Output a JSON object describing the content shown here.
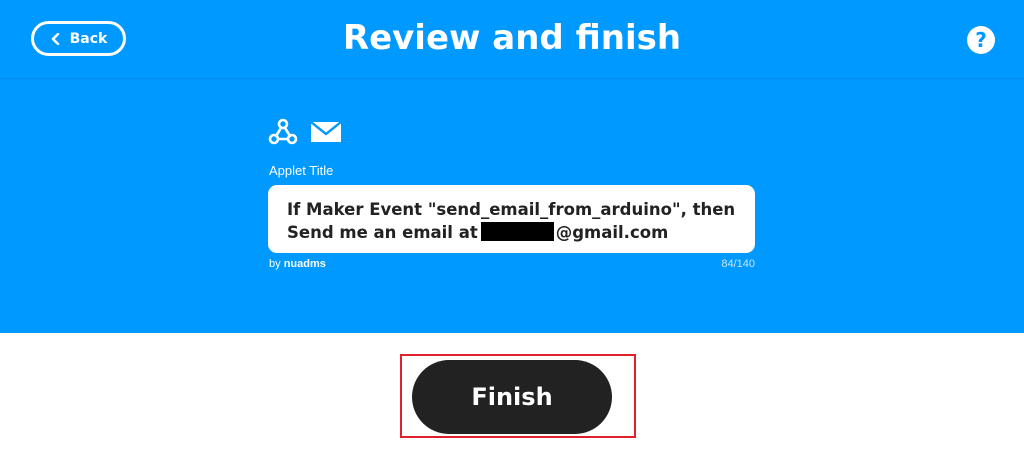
{
  "header": {
    "back_label": "Back",
    "title": "Review and finish",
    "help_label": "?"
  },
  "applet": {
    "service_icons": [
      "webhooks-icon",
      "email-icon"
    ],
    "title_label": "Applet Title",
    "title_line1": "If Maker Event \"send_email_from_arduino\", then",
    "title_line2_prefix": "Send me an email at",
    "title_line2_suffix": "@gmail.com",
    "by_prefix": "by",
    "author": "nuadms",
    "char_count": "84/140"
  },
  "actions": {
    "finish_label": "Finish"
  },
  "colors": {
    "brand_blue": "#0099ff",
    "button_dark": "#222222",
    "highlight_red": "#e0202a"
  }
}
